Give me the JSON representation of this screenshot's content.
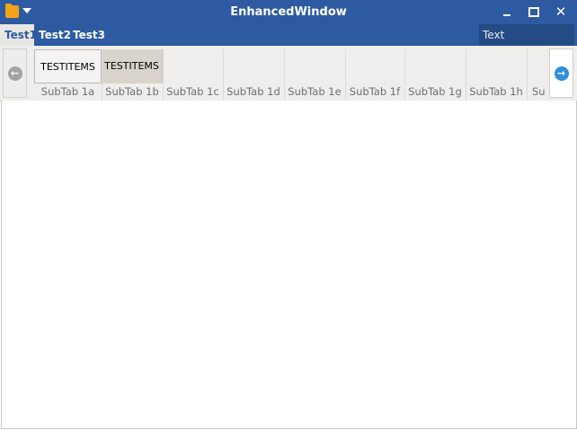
{
  "window": {
    "title": "EnhancedWindow",
    "icons": [
      "folder-icon",
      "menu-chevron-down-icon",
      "minimize-icon",
      "maximize-icon",
      "close-icon"
    ],
    "close_glyph": "✕"
  },
  "main_tabs": [
    {
      "label": "Test1",
      "active": true
    },
    {
      "label": "Test2",
      "active": false
    },
    {
      "label": "Test3",
      "active": false
    }
  ],
  "text_field": {
    "value": "Text"
  },
  "nav": {
    "left_glyph": "←",
    "right_glyph": "→"
  },
  "tool_items": [
    "TESTITEMS",
    "TESTITEMS"
  ],
  "subtabs": [
    "SubTab 1a",
    "SubTab 1b",
    "SubTab 1c",
    "SubTab 1d",
    "SubTab 1e",
    "SubTab 1f",
    "SubTab 1g",
    "SubTab 1h",
    "Su"
  ],
  "colors": {
    "accent": "#2d5aa0",
    "nav_button": "#2b90d9"
  }
}
